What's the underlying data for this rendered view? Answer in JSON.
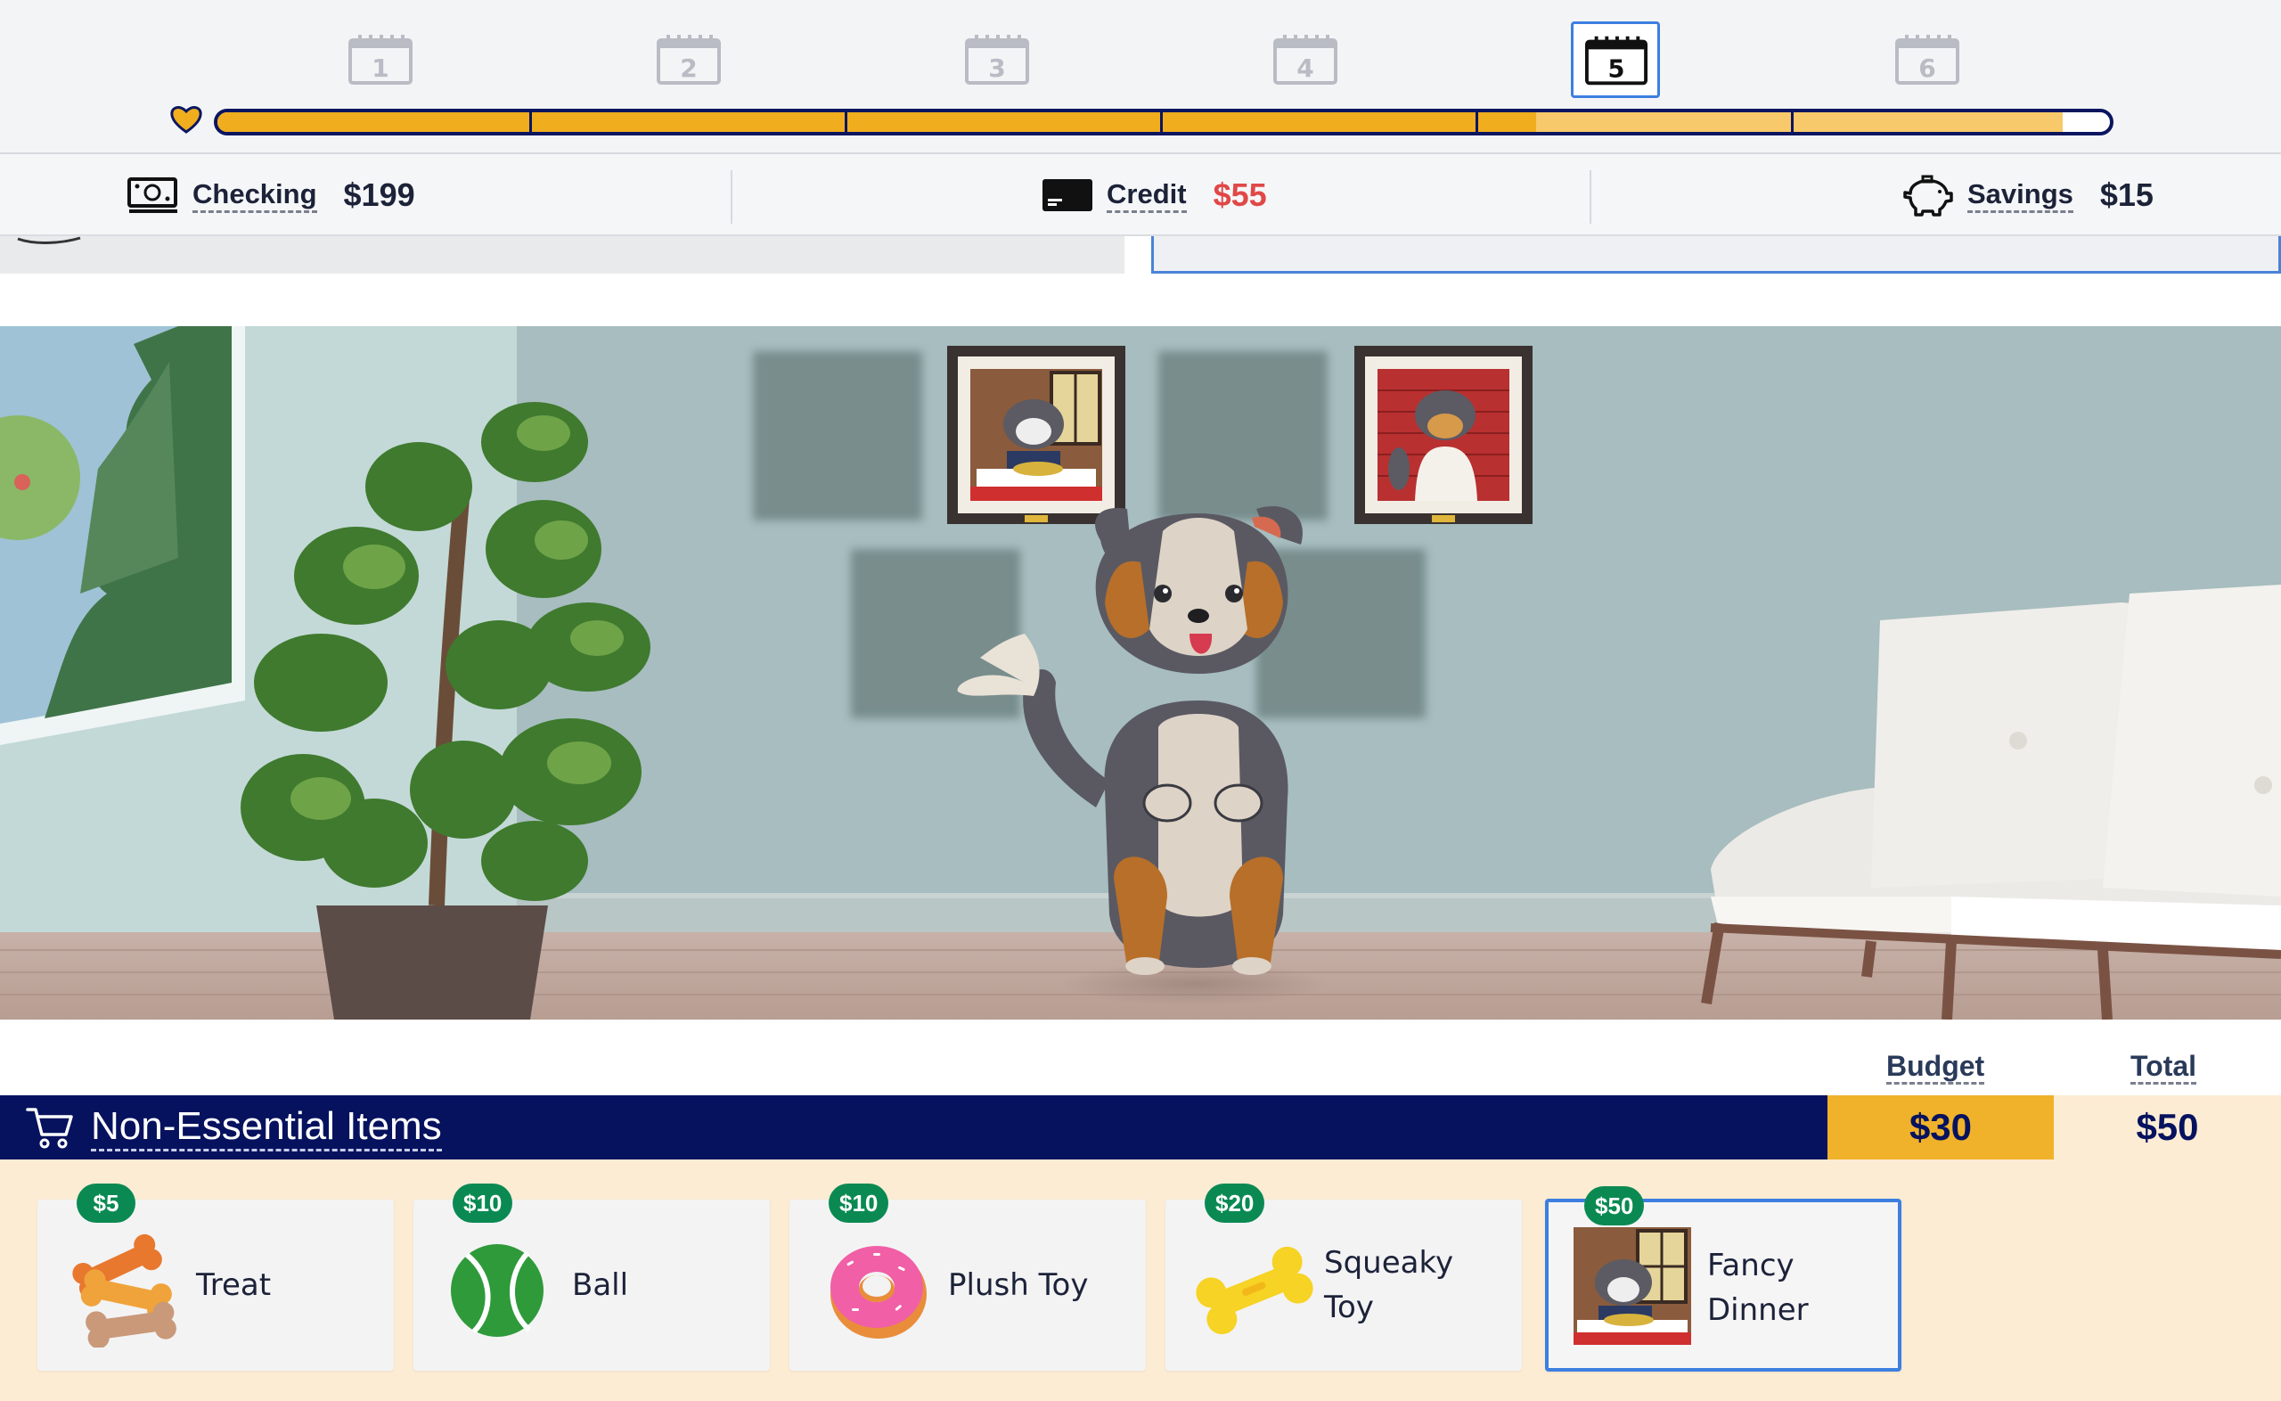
{
  "timeline": {
    "weeks": [
      "1",
      "2",
      "3",
      "4",
      "5",
      "6"
    ],
    "current_week": "5",
    "progress": 0.975,
    "completed_fraction": 0.697,
    "colors": {
      "fill": "#f0ad1e",
      "fill_light": "#f7c96a",
      "track": "#0b1660",
      "heart": "#f0ad1e"
    }
  },
  "accounts": {
    "checking": {
      "label": "Checking",
      "amount": "$199",
      "icon": "cash-icon"
    },
    "credit": {
      "label": "Credit",
      "amount": "$55",
      "icon": "credit-card-icon",
      "color": "#e04848"
    },
    "savings": {
      "label": "Savings",
      "amount": "$15",
      "icon": "piggy-bank-icon"
    }
  },
  "store": {
    "title": "Non-Essential Items",
    "budget_label": "Budget",
    "total_label": "Total",
    "budget_value": "$30",
    "total_value": "$50",
    "items": [
      {
        "price": "$5",
        "name": "Treat",
        "icon": "dog-biscuits-icon"
      },
      {
        "price": "$10",
        "name": "Ball",
        "icon": "tennis-ball-icon"
      },
      {
        "price": "$10",
        "name": "Plush Toy",
        "icon": "donut-plush-icon"
      },
      {
        "price": "$20",
        "name": "Squeaky Toy",
        "icon": "bone-toy-icon"
      },
      {
        "price": "$50",
        "name": "Fancy Dinner",
        "icon": "fancy-dinner-picture",
        "selected": true
      }
    ]
  }
}
